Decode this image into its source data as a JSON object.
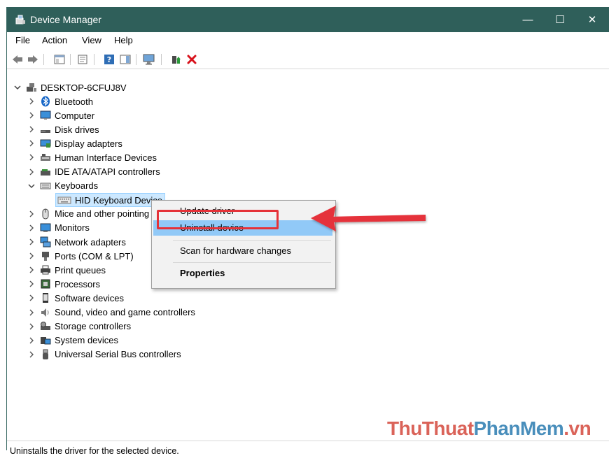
{
  "window": {
    "title": "Device Manager"
  },
  "window_controls": {
    "minimize": "—",
    "maximize": "☐",
    "close": "✕"
  },
  "menu": {
    "items": [
      "File",
      "Action",
      "View",
      "Help"
    ]
  },
  "tree": {
    "root": "DESKTOP-6CFUJ8V",
    "categories": [
      {
        "label": "Bluetooth",
        "icon": "bluetooth-icon"
      },
      {
        "label": "Computer",
        "icon": "computer-icon"
      },
      {
        "label": "Disk drives",
        "icon": "disk-drive-icon"
      },
      {
        "label": "Display adapters",
        "icon": "display-adapter-icon"
      },
      {
        "label": "Human Interface Devices",
        "icon": "hid-icon"
      },
      {
        "label": "IDE ATA/ATAPI controllers",
        "icon": "ide-controller-icon"
      },
      {
        "label": "Keyboards",
        "icon": "keyboard-icon",
        "expanded": true
      },
      {
        "label": "Mice and other pointing devices",
        "icon": "mouse-icon"
      },
      {
        "label": "Monitors",
        "icon": "monitor-icon"
      },
      {
        "label": "Network adapters",
        "icon": "network-adapter-icon"
      },
      {
        "label": "Ports (COM & LPT)",
        "icon": "port-icon"
      },
      {
        "label": "Print queues",
        "icon": "printer-icon"
      },
      {
        "label": "Processors",
        "icon": "processor-icon"
      },
      {
        "label": "Software devices",
        "icon": "software-device-icon"
      },
      {
        "label": "Sound, video and game controllers",
        "icon": "speaker-icon"
      },
      {
        "label": "Storage controllers",
        "icon": "storage-controller-icon"
      },
      {
        "label": "System devices",
        "icon": "system-device-icon"
      },
      {
        "label": "Universal Serial Bus controllers",
        "icon": "usb-icon"
      }
    ],
    "selected_child": "HID Keyboard Device"
  },
  "context_menu": {
    "items": [
      "Update driver",
      "Uninstall device",
      "Scan for hardware changes",
      "Properties"
    ],
    "highlighted": "Uninstall device"
  },
  "status": {
    "text": "Uninstalls the driver for the selected device."
  },
  "watermark": {
    "part1": "ThuThuat",
    "part2": "PhanMem",
    "part3": ".vn"
  },
  "colors": {
    "titlebar": "#2f5f5a",
    "highlight": "#91c9f7",
    "annotation": "#e53238"
  }
}
